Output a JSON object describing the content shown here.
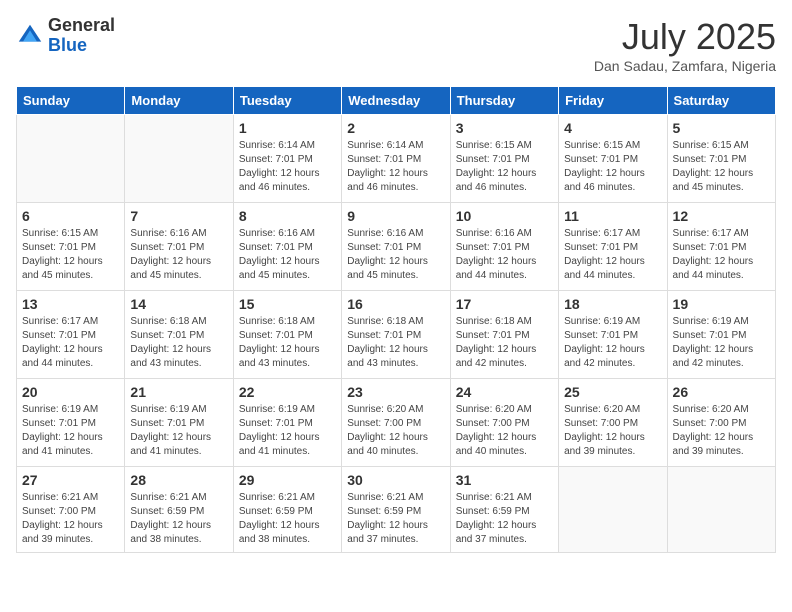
{
  "header": {
    "logo_general": "General",
    "logo_blue": "Blue",
    "month_title": "July 2025",
    "location": "Dan Sadau, Zamfara, Nigeria"
  },
  "weekdays": [
    "Sunday",
    "Monday",
    "Tuesday",
    "Wednesday",
    "Thursday",
    "Friday",
    "Saturday"
  ],
  "weeks": [
    [
      {
        "day": "",
        "info": ""
      },
      {
        "day": "",
        "info": ""
      },
      {
        "day": "1",
        "info": "Sunrise: 6:14 AM\nSunset: 7:01 PM\nDaylight: 12 hours and 46 minutes."
      },
      {
        "day": "2",
        "info": "Sunrise: 6:14 AM\nSunset: 7:01 PM\nDaylight: 12 hours and 46 minutes."
      },
      {
        "day": "3",
        "info": "Sunrise: 6:15 AM\nSunset: 7:01 PM\nDaylight: 12 hours and 46 minutes."
      },
      {
        "day": "4",
        "info": "Sunrise: 6:15 AM\nSunset: 7:01 PM\nDaylight: 12 hours and 46 minutes."
      },
      {
        "day": "5",
        "info": "Sunrise: 6:15 AM\nSunset: 7:01 PM\nDaylight: 12 hours and 45 minutes."
      }
    ],
    [
      {
        "day": "6",
        "info": "Sunrise: 6:15 AM\nSunset: 7:01 PM\nDaylight: 12 hours and 45 minutes."
      },
      {
        "day": "7",
        "info": "Sunrise: 6:16 AM\nSunset: 7:01 PM\nDaylight: 12 hours and 45 minutes."
      },
      {
        "day": "8",
        "info": "Sunrise: 6:16 AM\nSunset: 7:01 PM\nDaylight: 12 hours and 45 minutes."
      },
      {
        "day": "9",
        "info": "Sunrise: 6:16 AM\nSunset: 7:01 PM\nDaylight: 12 hours and 45 minutes."
      },
      {
        "day": "10",
        "info": "Sunrise: 6:16 AM\nSunset: 7:01 PM\nDaylight: 12 hours and 44 minutes."
      },
      {
        "day": "11",
        "info": "Sunrise: 6:17 AM\nSunset: 7:01 PM\nDaylight: 12 hours and 44 minutes."
      },
      {
        "day": "12",
        "info": "Sunrise: 6:17 AM\nSunset: 7:01 PM\nDaylight: 12 hours and 44 minutes."
      }
    ],
    [
      {
        "day": "13",
        "info": "Sunrise: 6:17 AM\nSunset: 7:01 PM\nDaylight: 12 hours and 44 minutes."
      },
      {
        "day": "14",
        "info": "Sunrise: 6:18 AM\nSunset: 7:01 PM\nDaylight: 12 hours and 43 minutes."
      },
      {
        "day": "15",
        "info": "Sunrise: 6:18 AM\nSunset: 7:01 PM\nDaylight: 12 hours and 43 minutes."
      },
      {
        "day": "16",
        "info": "Sunrise: 6:18 AM\nSunset: 7:01 PM\nDaylight: 12 hours and 43 minutes."
      },
      {
        "day": "17",
        "info": "Sunrise: 6:18 AM\nSunset: 7:01 PM\nDaylight: 12 hours and 42 minutes."
      },
      {
        "day": "18",
        "info": "Sunrise: 6:19 AM\nSunset: 7:01 PM\nDaylight: 12 hours and 42 minutes."
      },
      {
        "day": "19",
        "info": "Sunrise: 6:19 AM\nSunset: 7:01 PM\nDaylight: 12 hours and 42 minutes."
      }
    ],
    [
      {
        "day": "20",
        "info": "Sunrise: 6:19 AM\nSunset: 7:01 PM\nDaylight: 12 hours and 41 minutes."
      },
      {
        "day": "21",
        "info": "Sunrise: 6:19 AM\nSunset: 7:01 PM\nDaylight: 12 hours and 41 minutes."
      },
      {
        "day": "22",
        "info": "Sunrise: 6:19 AM\nSunset: 7:01 PM\nDaylight: 12 hours and 41 minutes."
      },
      {
        "day": "23",
        "info": "Sunrise: 6:20 AM\nSunset: 7:00 PM\nDaylight: 12 hours and 40 minutes."
      },
      {
        "day": "24",
        "info": "Sunrise: 6:20 AM\nSunset: 7:00 PM\nDaylight: 12 hours and 40 minutes."
      },
      {
        "day": "25",
        "info": "Sunrise: 6:20 AM\nSunset: 7:00 PM\nDaylight: 12 hours and 39 minutes."
      },
      {
        "day": "26",
        "info": "Sunrise: 6:20 AM\nSunset: 7:00 PM\nDaylight: 12 hours and 39 minutes."
      }
    ],
    [
      {
        "day": "27",
        "info": "Sunrise: 6:21 AM\nSunset: 7:00 PM\nDaylight: 12 hours and 39 minutes."
      },
      {
        "day": "28",
        "info": "Sunrise: 6:21 AM\nSunset: 6:59 PM\nDaylight: 12 hours and 38 minutes."
      },
      {
        "day": "29",
        "info": "Sunrise: 6:21 AM\nSunset: 6:59 PM\nDaylight: 12 hours and 38 minutes."
      },
      {
        "day": "30",
        "info": "Sunrise: 6:21 AM\nSunset: 6:59 PM\nDaylight: 12 hours and 37 minutes."
      },
      {
        "day": "31",
        "info": "Sunrise: 6:21 AM\nSunset: 6:59 PM\nDaylight: 12 hours and 37 minutes."
      },
      {
        "day": "",
        "info": ""
      },
      {
        "day": "",
        "info": ""
      }
    ]
  ]
}
